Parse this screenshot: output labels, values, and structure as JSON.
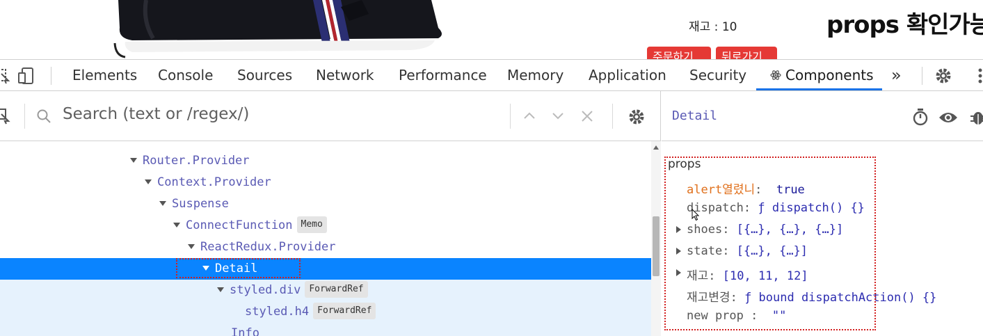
{
  "page": {
    "stock_text": "재고 : 10",
    "note_text": "props 확인가능",
    "order_button": "주문하기",
    "back_button": "뒤로가기"
  },
  "devtools": {
    "tabs": [
      {
        "label": "Elements"
      },
      {
        "label": "Console"
      },
      {
        "label": "Sources"
      },
      {
        "label": "Network"
      },
      {
        "label": "Performance"
      },
      {
        "label": "Memory"
      },
      {
        "label": "Application"
      },
      {
        "label": "Security"
      },
      {
        "label": "Components",
        "icon": "react-atom-icon",
        "active": true
      }
    ],
    "more_tabs": "»"
  },
  "search": {
    "placeholder": "Search (text or /regex/)"
  },
  "tree": {
    "rows": [
      {
        "label": "Router.Provider"
      },
      {
        "label": "Context.Provider"
      },
      {
        "label": "Suspense"
      },
      {
        "label": "ConnectFunction",
        "badge": "Memo"
      },
      {
        "label": "ReactRedux.Provider"
      },
      {
        "label": "Detail",
        "selected": true
      },
      {
        "label": "styled.div",
        "badge": "ForwardRef"
      },
      {
        "label": "styled.h4",
        "badge": "ForwardRef"
      },
      {
        "label": "Info"
      }
    ]
  },
  "inspector": {
    "component": "Detail",
    "section_title": "props",
    "props": [
      {
        "key": "alert열렸니",
        "sep": ":",
        "value": "true",
        "warn": true,
        "expandable": false
      },
      {
        "key": "dispatch",
        "sep": ":",
        "value": "ƒ dispatch() {}",
        "expandable": false
      },
      {
        "key": "shoes",
        "sep": ":",
        "value": "[{…}, {…}, {…}]",
        "expandable": true
      },
      {
        "key": "state",
        "sep": ":",
        "value": "[{…}, {…}]",
        "expandable": true
      },
      {
        "key": "재고",
        "sep": ":",
        "value": "[10, 11, 12]",
        "expandable": true
      },
      {
        "key": "재고변경",
        "sep": ":",
        "value": "ƒ bound dispatchAction() {}",
        "expandable": false
      },
      {
        "key": "new prop",
        "sep": " :",
        "value": "\"\"",
        "expandable": false
      }
    ]
  },
  "colors": {
    "selection": "#0a84ff",
    "selection_children": "#e6f2fd",
    "component_name": "#5a5ab4",
    "annotation_border": "#d21f1f",
    "active_tab_underline": "#1a73e8",
    "page_button": "#e53935"
  }
}
